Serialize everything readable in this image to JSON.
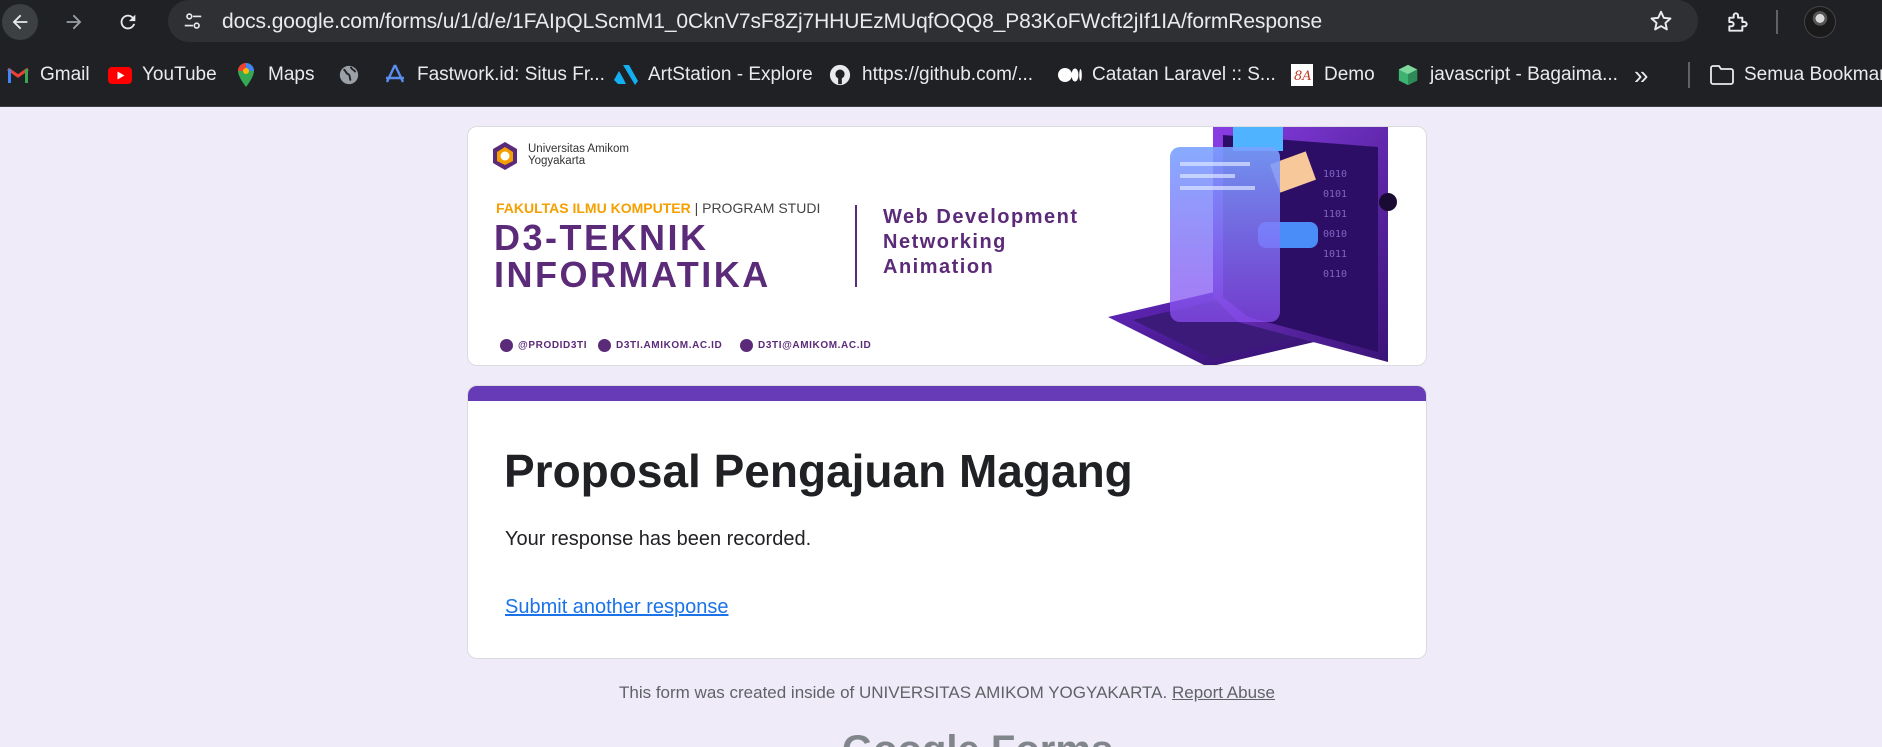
{
  "browser": {
    "url": "docs.google.com/forms/u/1/d/e/1FAIpQLScmM1_0CknV7sF8Zj7HHUEzMUqfOQQ8_P83KoFWcft2jIf1IA/formResponse",
    "icons": {
      "back": "arrow-left-icon",
      "forward": "arrow-right-icon",
      "reload": "reload-icon",
      "site_info": "tune-icon",
      "bookmark_star": "star-icon",
      "extensions": "puzzle-icon"
    }
  },
  "bookmarks": {
    "items": [
      {
        "label": "Gmail",
        "icon": "gmail-icon"
      },
      {
        "label": "YouTube",
        "icon": "youtube-icon"
      },
      {
        "label": "Maps",
        "icon": "maps-icon"
      },
      {
        "label": "",
        "icon": "globe-icon"
      },
      {
        "label": "Fastwork.id: Situs Fr...",
        "icon": "fastwork-icon"
      },
      {
        "label": "ArtStation - Explore",
        "icon": "artstation-icon"
      },
      {
        "label": "https://github.com/...",
        "icon": "github-icon"
      },
      {
        "label": "Catatan Laravel :: S...",
        "icon": "medium-icon"
      },
      {
        "label": "Demo",
        "icon": "demo-icon"
      },
      {
        "label": "javascript - Bagaima...",
        "icon": "cube-icon"
      }
    ],
    "more": "»",
    "folder": {
      "label": "Semua Bookmark",
      "icon": "folder-icon"
    }
  },
  "banner": {
    "university": [
      "Universitas Amikom",
      "Yogyakarta"
    ],
    "faculty": "FAKULTAS ILMU KOMPUTER",
    "program_label": "PROGRAM STUDI",
    "program_lines": [
      "D3-TEKNIK",
      "INFORMATIKA"
    ],
    "tracks": [
      "Web Development",
      "Networking",
      "Animation"
    ],
    "socials": [
      "@PRODID3TI",
      "D3TI.AMIKOM.AC.ID",
      "D3TI@AMIKOM.AC.ID"
    ]
  },
  "form": {
    "title": "Proposal Pengajuan Magang",
    "confirmation": "Your response has been recorded.",
    "submit_another": "Submit another response",
    "accent_color": "#673ab7"
  },
  "footer": {
    "text": "This form was created inside of UNIVERSITAS AMIKOM YOGYAKARTA.",
    "report_link": "Report Abuse",
    "brand": "Google Forms"
  }
}
